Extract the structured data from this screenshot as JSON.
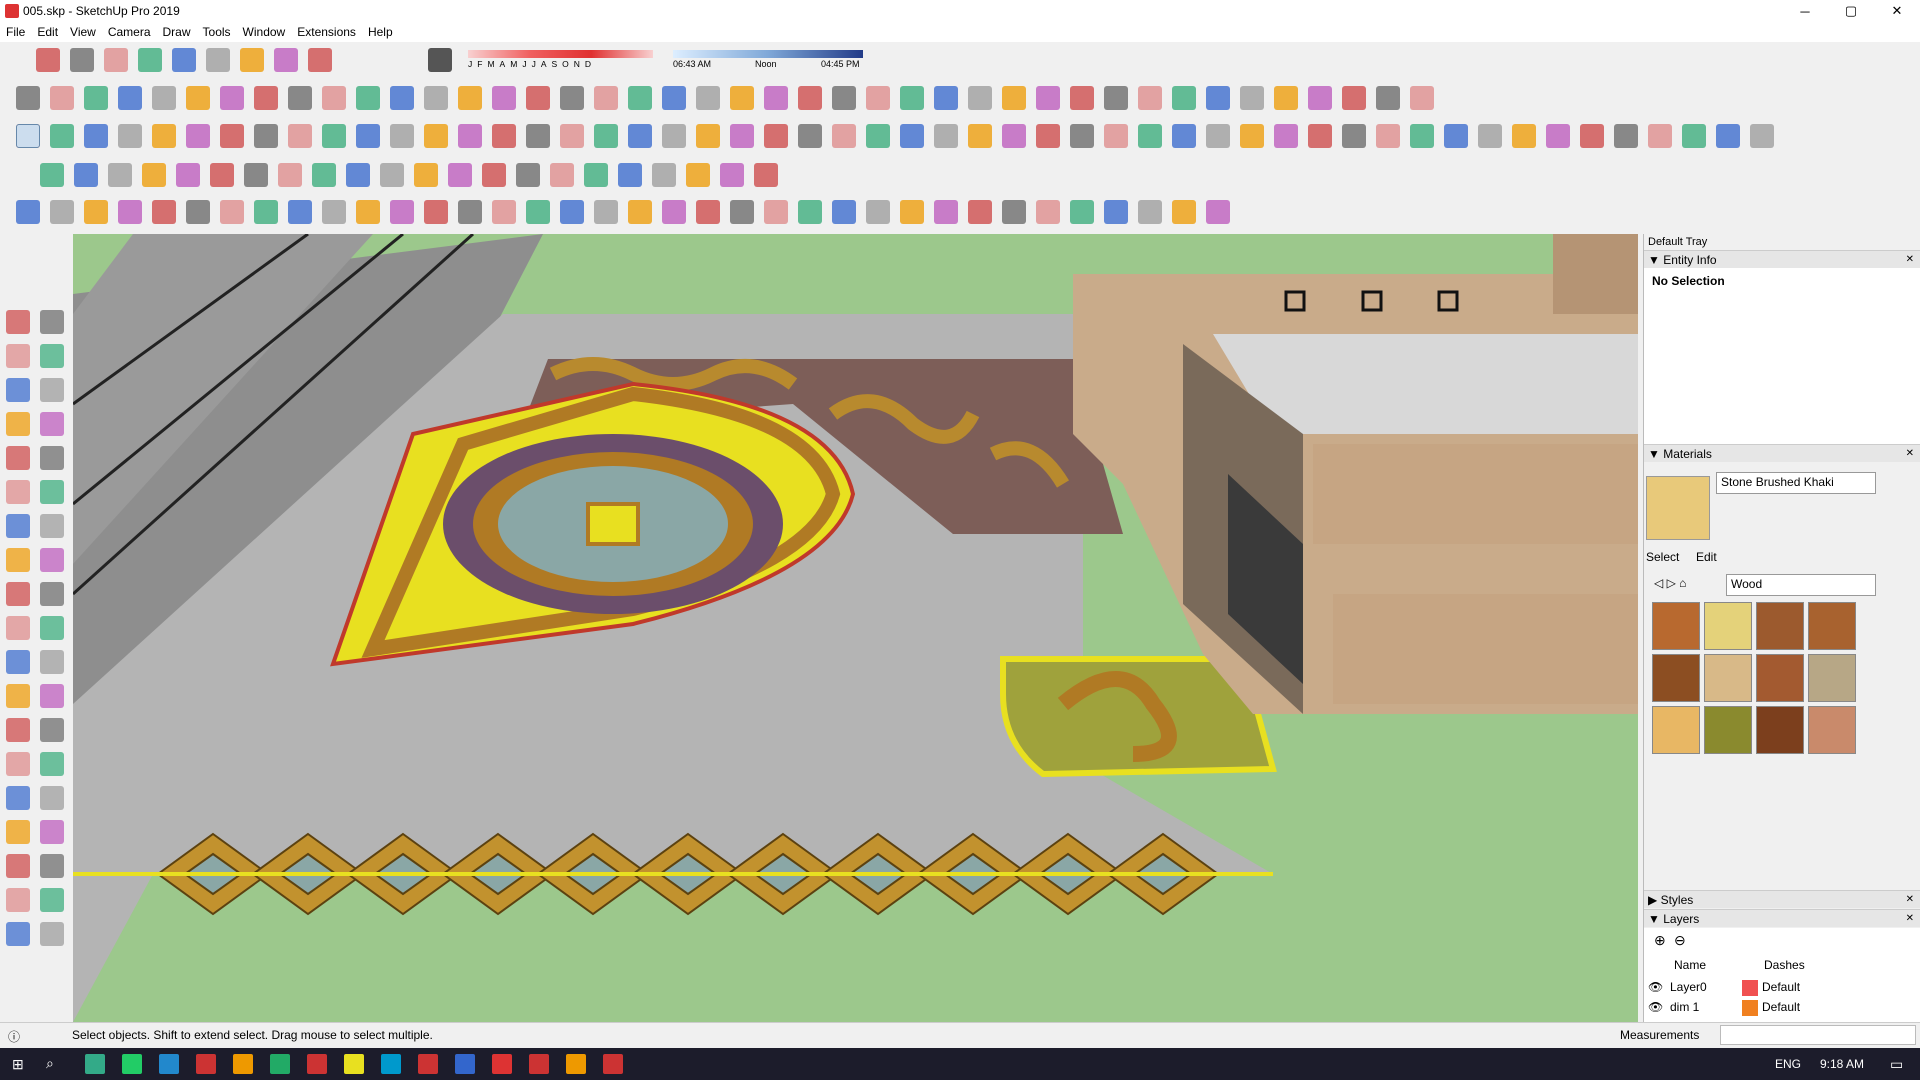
{
  "window": {
    "title": "005.skp - SketchUp Pro 2019",
    "minimize": "─",
    "maximize": "▢",
    "close": "✕"
  },
  "menu": [
    "File",
    "Edit",
    "View",
    "Camera",
    "Draw",
    "Tools",
    "Window",
    "Extensions",
    "Help"
  ],
  "shadows": {
    "months": [
      "J",
      "F",
      "M",
      "A",
      "M",
      "J",
      "J",
      "A",
      "S",
      "O",
      "N",
      "D"
    ],
    "time_start": "06:43 AM",
    "time_mid": "Noon",
    "time_end": "04:45 PM"
  },
  "tray": {
    "title": "Default Tray",
    "entity_info": {
      "header": "Entity Info",
      "value": "No Selection"
    },
    "materials": {
      "header": "Materials",
      "current": "Stone Brushed Khaki",
      "tab_select": "Select",
      "tab_edit": "Edit",
      "library": "Wood",
      "swatch_colors": [
        "#b8692f",
        "#e4d27a",
        "#9c5a2e",
        "#a8622f",
        "#8c4e22",
        "#d8b988",
        "#a35a30",
        "#b7a786",
        "#e8b764",
        "#8a8a2e",
        "#7c3f1d",
        "#c98a6b"
      ]
    },
    "styles": {
      "header": "Styles"
    },
    "layers": {
      "header": "Layers",
      "col_name": "Name",
      "col_dashes": "Dashes",
      "rows": [
        {
          "name": "Layer0",
          "dashes": "Default",
          "color": "#f05050"
        },
        {
          "name": "dim 1",
          "dashes": "Default",
          "color": "#f08020"
        }
      ]
    }
  },
  "status": {
    "message": "Select objects. Shift to extend select. Drag mouse to select multiple.",
    "measurements_label": "Measurements"
  },
  "taskbar": {
    "lang": "ENG",
    "time": "9:18 AM"
  },
  "colors": {
    "grass": "#9cc88c",
    "road": "#b4b4b4",
    "wall": "#c9ab8a",
    "yellow": "#e8e020",
    "accent_red": "#d33"
  }
}
